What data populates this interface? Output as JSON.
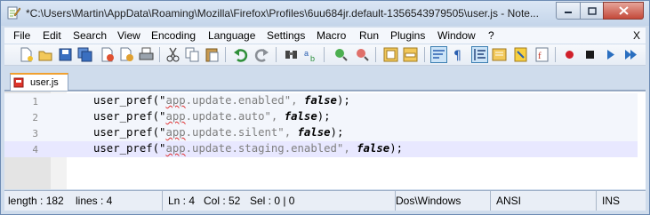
{
  "window": {
    "title": "*C:\\Users\\Martin\\AppData\\Roaming\\Mozilla\\Firefox\\Profiles\\6uu684jr.default-1356543979505\\user.js - Note..."
  },
  "menu": {
    "items": [
      "File",
      "Edit",
      "Search",
      "View",
      "Encoding",
      "Language",
      "Settings",
      "Macro",
      "Run",
      "Plugins",
      "Window",
      "?"
    ],
    "close_doc": "X"
  },
  "toolbar": {
    "icons": [
      "new-file-icon",
      "open-file-icon",
      "save-icon",
      "save-all-icon",
      "close-icon",
      "close-all-icon",
      "print-icon",
      "cut-icon",
      "copy-icon",
      "paste-icon",
      "undo-icon",
      "redo-icon",
      "find-icon",
      "replace-icon",
      "zoom-in-icon",
      "zoom-out-icon",
      "sync-vertical-icon",
      "sync-horizontal-icon",
      "word-wrap-icon",
      "show-all-characters-icon",
      "indent-guide-icon",
      "folder-as-workspace-icon",
      "document-map-icon",
      "function-list-icon",
      "record-macro-icon",
      "stop-macro-icon",
      "play-macro-icon",
      "run-macro-multiple-icon"
    ]
  },
  "tabs": [
    {
      "label": "user.js",
      "modified": true
    }
  ],
  "editor": {
    "lines": [
      {
        "num": "1",
        "prefix": "user_pref(\"",
        "squiggle": "app",
        "rest": ".update.enabled\", ",
        "kw": "false",
        "suffix": ");"
      },
      {
        "num": "2",
        "prefix": "user_pref(\"",
        "squiggle": "app",
        "rest": ".update.auto\", ",
        "kw": "false",
        "suffix": ");"
      },
      {
        "num": "3",
        "prefix": "user_pref(\"",
        "squiggle": "app",
        "rest": ".update.silent\", ",
        "kw": "false",
        "suffix": ");"
      },
      {
        "num": "4",
        "prefix": "user_pref(\"",
        "squiggle": "app",
        "rest": ".update.staging.enabled\", ",
        "kw": "false",
        "suffix": ");"
      }
    ],
    "current_line": 4
  },
  "status": {
    "length": "length : 182",
    "lines": "lines : 4",
    "ln": "Ln : 4",
    "col": "Col : 52",
    "sel": "Sel : 0 | 0",
    "eol": "Dos\\Windows",
    "encoding": "ANSI",
    "mode": "INS"
  },
  "colors": {
    "tab_accent": "#f0a030",
    "current_line": "#e8e8ff",
    "close_button": "#c4493a"
  }
}
